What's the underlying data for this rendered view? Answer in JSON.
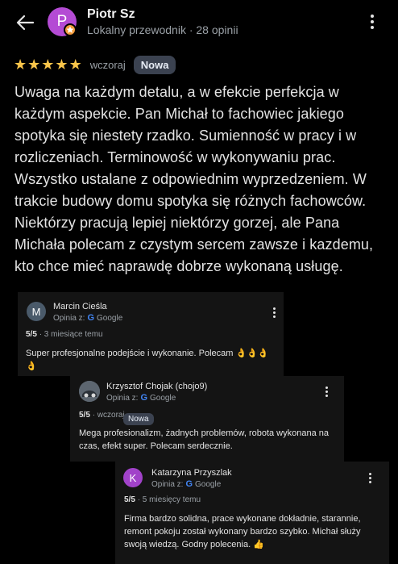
{
  "header": {
    "name": "Piotr Sz",
    "avatar_letter": "P",
    "subtitle": "Lokalny przewodnik · 28 opinii"
  },
  "review": {
    "stars": 5,
    "when": "wczoraj",
    "badge": "Nowa",
    "text": "Uwaga na każdym detalu, a w efekcie perfekcja w każdym aspekcie. Pan Michał to fachowiec jakiego spotyka się niestety rzadko. Sumienność w pracy i w rozliczeniach. Terminowość w wykonywaniu prac. Wszystko ustalane z odpowiednim wyprzedzeniem. W trakcie budowy domu spotyka się różnych fachowców. Niektórzy pracują lepiej niektórzy gorzej, ale Pana Michała polecam z czystym sercem zawsze i kazdemu, kto chce mieć naprawdę dobrze wykonaną usługę."
  },
  "comments": [
    {
      "name": "Marcin Cieśla",
      "avatar_letter": "M",
      "via_label": "Opinia z:",
      "source": "Google",
      "rating": "5/5",
      "when": "· 3 miesiące temu",
      "text": "Super profesjonalne podejście i wykonanie. Polecam 👌👌👌👌"
    },
    {
      "name": "Krzysztof Chojak (chojo9)",
      "via_label": "Opinia z:",
      "source": "Google",
      "rating": "5/5",
      "when": "· wczoraj",
      "badge": "Nowa",
      "text": "Mega profesionalizm, żadnych problemów, robota wykonana na czas, efekt super. Polecam serdecznie."
    },
    {
      "name": "Katarzyna Przyszlak",
      "avatar_letter": "K",
      "via_label": "Opinia z:",
      "source": "Google",
      "rating": "5/5",
      "when": "· 5 miesięcy temu",
      "text": "Firma bardzo solidna, prace wykonane dokładnie, starannie, remont pokoju został wykonany bardzo szybko. Michał służy swoją wiedzą. Godny polecenia. 👍"
    }
  ],
  "colors": {
    "star": "#f9c54a",
    "avatar_p": "#b44bd4",
    "avatar_m": "#4a5a6a",
    "avatar_k": "#a142c9",
    "badge_bg": "#3b4250"
  },
  "icons": {
    "back": "arrow-left-icon",
    "menu": "more-vert-icon",
    "guide": "local-guide-star-icon",
    "star": "star-icon"
  }
}
